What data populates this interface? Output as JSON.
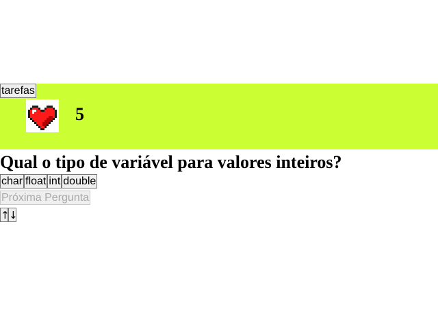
{
  "toolbar": {
    "tasks_label": "tarefas"
  },
  "status": {
    "lives": "5",
    "lives_icon": "heart-icon",
    "banner_color": "#ccff33",
    "heart_color": "#ff1a1a"
  },
  "quiz": {
    "question": "Qual o tipo de variável para valores inteiros?",
    "options": [
      "char",
      "float",
      "int",
      "double"
    ],
    "next_label": "Próxima Pergunta"
  },
  "controls": {
    "up_label": "↑",
    "down_label": "↓"
  }
}
